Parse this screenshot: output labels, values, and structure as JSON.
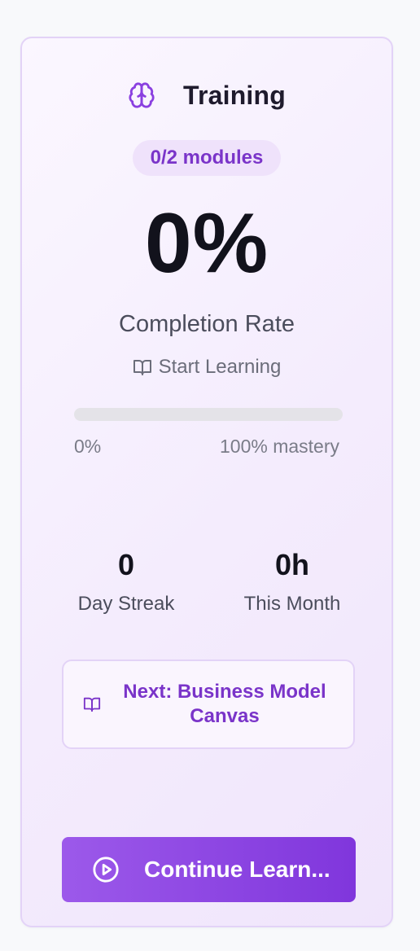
{
  "card": {
    "title": "Training",
    "icon": "brain-icon",
    "modules_badge": "0/2 modules",
    "completion_value": "0%",
    "completion_label": "Completion Rate",
    "start_label": "Start Learning",
    "start_icon": "book-open-icon",
    "progress": {
      "fraction": 0,
      "min_label": "0%",
      "max_label": "100% mastery"
    },
    "stats": [
      {
        "value": "0",
        "label": "Day Streak"
      },
      {
        "value": "0h",
        "label": "This Month"
      }
    ],
    "next_module": {
      "label": "Next: Business Model Canvas",
      "icon": "book-open-icon"
    },
    "cta": {
      "label": "Continue Learn...",
      "icon": "play-circle-icon"
    }
  },
  "colors": {
    "accent": "#8036dc",
    "accent_text": "#7a34c9",
    "badge_bg": "#efe2fb",
    "card_border": "#e3d3f7",
    "track": "#e4e3e8"
  }
}
